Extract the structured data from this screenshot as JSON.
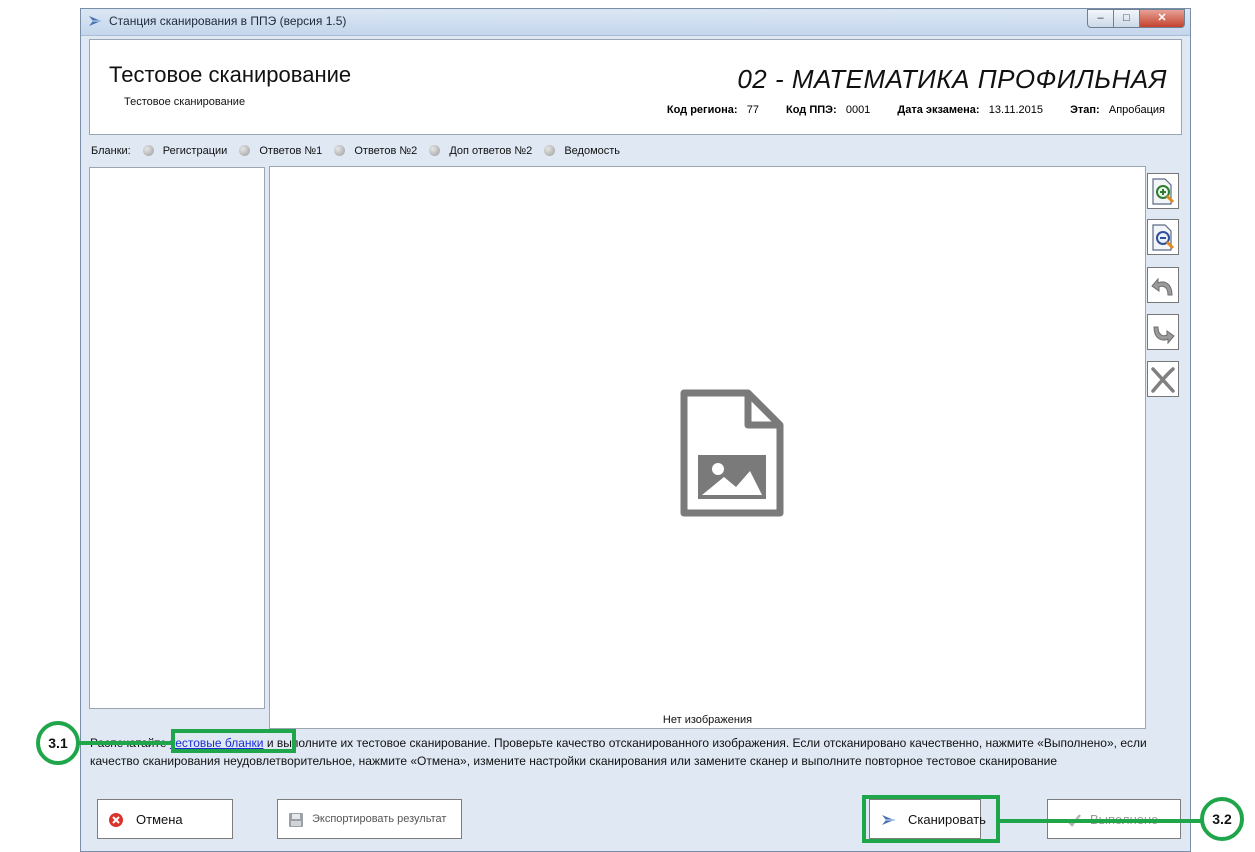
{
  "window": {
    "title": "Станция сканирования в ППЭ (версия 1.5)",
    "controls": {
      "minimize": "–",
      "maximize": "□",
      "close": "✕"
    }
  },
  "header": {
    "title": "Тестовое сканирование",
    "subtitle": "Тестовое сканирование",
    "exam": "02 - МАТЕМАТИКА ПРОФИЛЬНАЯ",
    "meta": [
      {
        "label": "Код региона:",
        "value": "77"
      },
      {
        "label": "Код ППЭ:",
        "value": "0001"
      },
      {
        "label": "Дата экзамена:",
        "value": "13.11.2015"
      },
      {
        "label": "Этап:",
        "value": "Апробация"
      }
    ]
  },
  "blanks": {
    "label": "Бланки:",
    "items": [
      "Регистрации",
      "Ответов №1",
      "Ответов №2",
      "Доп ответов №2",
      "Ведомость"
    ]
  },
  "viewer": {
    "empty_label": "Нет изображения",
    "tools": [
      "zoom-in-icon",
      "zoom-out-icon",
      "rotate-left-icon",
      "rotate-right-icon",
      "delete-icon"
    ]
  },
  "instruction": {
    "before_link": "Распечатайте ",
    "link": "тестовые бланки",
    "after_link": " и выполните их тестовое сканирование. Проверьте качество отсканированного изображения. Если отсканировано качественно, нажмите «Выполнено», если качество сканирования неудовлетворительное, нажмите «Отмена», измените настройки сканирования или замените сканер и выполните повторное тестовое сканирование"
  },
  "buttons": {
    "cancel": "Отмена",
    "export": "Экспортировать результат",
    "scan": "Сканировать",
    "done": "Выполнено"
  },
  "callouts": {
    "first": "3.1",
    "second": "3.2"
  },
  "colors": {
    "callout": "#1fa64a",
    "link": "#1b2cd6",
    "cancel_icon": "#d9342b"
  }
}
